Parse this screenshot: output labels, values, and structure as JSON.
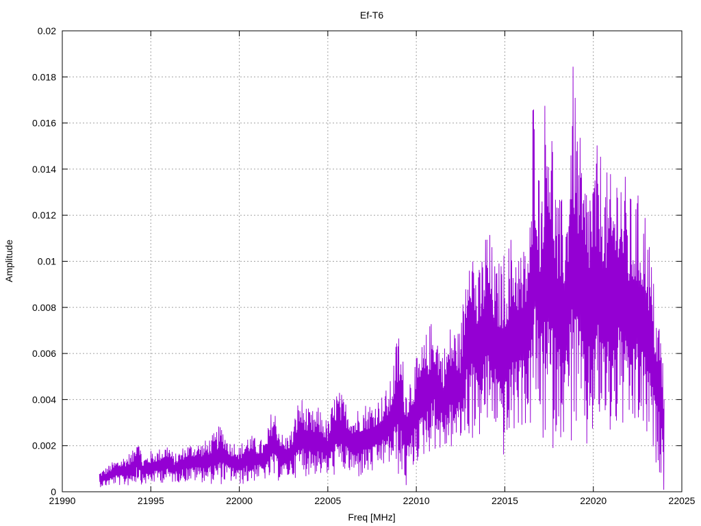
{
  "chart_data": {
    "type": "line",
    "title": "Ef-T6",
    "xlabel": "Freq [MHz]",
    "ylabel": "Amplitude",
    "xlim": [
      21990,
      22025
    ],
    "ylim": [
      0,
      0.02
    ],
    "x_ticks": [
      21990,
      21995,
      22000,
      22005,
      22010,
      22015,
      22020,
      22025
    ],
    "y_ticks": [
      0,
      0.002,
      0.004,
      0.006,
      0.008,
      0.01,
      0.012,
      0.014,
      0.016,
      0.018,
      0.02
    ],
    "x_tick_labels": [
      "21990",
      "21995",
      "22000",
      "22005",
      "22010",
      "22015",
      "22020",
      "22025"
    ],
    "y_tick_labels": [
      "0",
      "0.002",
      "0.004",
      "0.006",
      "0.008",
      "0.01",
      "0.012",
      "0.014",
      "0.016",
      "0.018",
      "0.02"
    ],
    "grid": true,
    "series": [
      {
        "color": "#9400D3",
        "x_start": 21992.1,
        "x_end": 22024.0,
        "x": [
          21992.1,
          21992.5,
          21993.0,
          21993.5,
          21994.0,
          21994.3,
          21994.5,
          21995.0,
          21995.5,
          21996.0,
          21996.3,
          21997.0,
          21997.5,
          21998.0,
          21998.5,
          21999.0,
          21999.5,
          21999.8,
          22000.0,
          22000.5,
          22001.0,
          22001.5,
          22001.9,
          22002.5,
          22003.0,
          22003.4,
          22004.0,
          22004.5,
          22005.0,
          22005.5,
          22006.0,
          22006.5,
          22007.0,
          22007.5,
          22008.0,
          22008.5,
          22009.0,
          22009.4,
          22010.0,
          22010.5,
          22011.0,
          22011.5,
          22012.0,
          22012.5,
          22013.0,
          22013.5,
          22014.0,
          22014.5,
          22015.0,
          22015.5,
          22016.0,
          22016.5,
          22016.6,
          22017.0,
          22017.4,
          22018.0,
          22018.5,
          22018.8,
          22019.3,
          22019.5,
          22020.0,
          22020.3,
          22020.7,
          22021.0,
          22021.5,
          22022.0,
          22022.5,
          22023.0,
          22023.5,
          22023.8,
          22024.0
        ],
        "peaks": [
          0.0009,
          0.0011,
          0.0014,
          0.0016,
          0.0018,
          0.0028,
          0.0015,
          0.0018,
          0.0019,
          0.0022,
          0.0016,
          0.0021,
          0.0022,
          0.0022,
          0.0025,
          0.003,
          0.0022,
          0.0023,
          0.002,
          0.0026,
          0.0023,
          0.0023,
          0.0039,
          0.0024,
          0.0028,
          0.0043,
          0.0035,
          0.0037,
          0.0031,
          0.0046,
          0.004,
          0.0036,
          0.0039,
          0.004,
          0.0042,
          0.0047,
          0.0073,
          0.005,
          0.0058,
          0.0068,
          0.0078,
          0.0062,
          0.0075,
          0.007,
          0.0125,
          0.0095,
          0.012,
          0.0098,
          0.0106,
          0.0115,
          0.0105,
          0.0125,
          0.0183,
          0.0135,
          0.0194,
          0.0127,
          0.013,
          0.019,
          0.015,
          0.014,
          0.0145,
          0.0153,
          0.014,
          0.0138,
          0.015,
          0.013,
          0.013,
          0.0125,
          0.0085,
          0.0075,
          0.005
        ],
        "troughs": [
          0.0002,
          0.0002,
          0.0003,
          0.0002,
          0.0003,
          0.0004,
          0.0003,
          0.0003,
          0.0004,
          0.0003,
          0.0004,
          0.0004,
          0.0004,
          0.0004,
          0.0003,
          0.0003,
          0.0004,
          0.0003,
          0.0003,
          0.0003,
          0.0005,
          0.0005,
          0.0004,
          0.0005,
          0.0006,
          0.0006,
          0.0007,
          0.0007,
          0.0006,
          0.0007,
          0.0008,
          0.0005,
          0.0006,
          0.0007,
          0.001,
          0.0011,
          0.0006,
          0.0,
          0.0012,
          0.0015,
          0.0018,
          0.0016,
          0.0018,
          0.002,
          0.0021,
          0.0022,
          0.0025,
          0.0026,
          0.0012,
          0.0023,
          0.0028,
          0.0025,
          0.003,
          0.0025,
          0.001,
          0.0024,
          0.0022,
          0.0018,
          0.0025,
          0.0009,
          0.0022,
          0.0025,
          0.0023,
          0.002,
          0.0026,
          0.0021,
          0.0025,
          0.0019,
          0.0012,
          0.0007,
          0.0
        ]
      }
    ]
  }
}
